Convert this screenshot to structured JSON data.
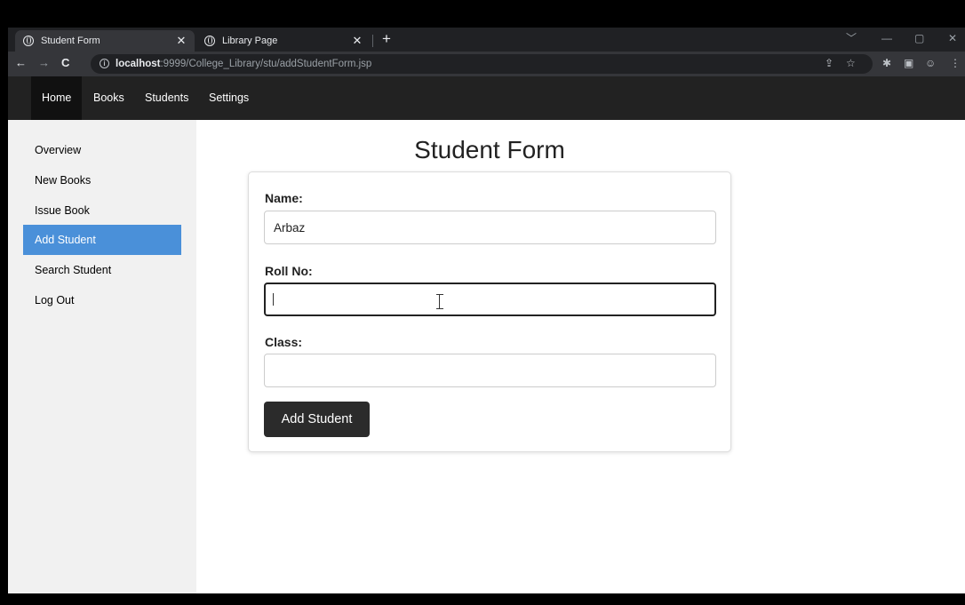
{
  "browser": {
    "tabs": [
      {
        "label": "Student Form",
        "active": true
      },
      {
        "label": "Library Page",
        "active": false
      }
    ],
    "new_tab_glyph": "+",
    "close_glyph": "✕",
    "url_host": "localhost",
    "url_rest": ":9999/College_Library/stu/addStudentForm.jsp",
    "window_controls": [
      "﹀",
      "—",
      "▢",
      "✕"
    ]
  },
  "site_nav": {
    "links": [
      "Home",
      "Books",
      "Students",
      "Settings"
    ],
    "active": "Home"
  },
  "sidebar": {
    "items": [
      "Overview",
      "New Books",
      "Issue Book",
      "Add Student",
      "Search Student",
      "Log Out"
    ],
    "active": "Add Student"
  },
  "form": {
    "title": "Student Form",
    "name_label": "Name:",
    "name_value": "Arbaz",
    "roll_label": "Roll No:",
    "roll_value": "",
    "class_label": "Class:",
    "class_value": "",
    "submit_label": "Add Student"
  },
  "colors": {
    "sidebar_active": "#4a90d9",
    "nav_bg": "#222222",
    "button_bg": "#2b2b2b"
  }
}
